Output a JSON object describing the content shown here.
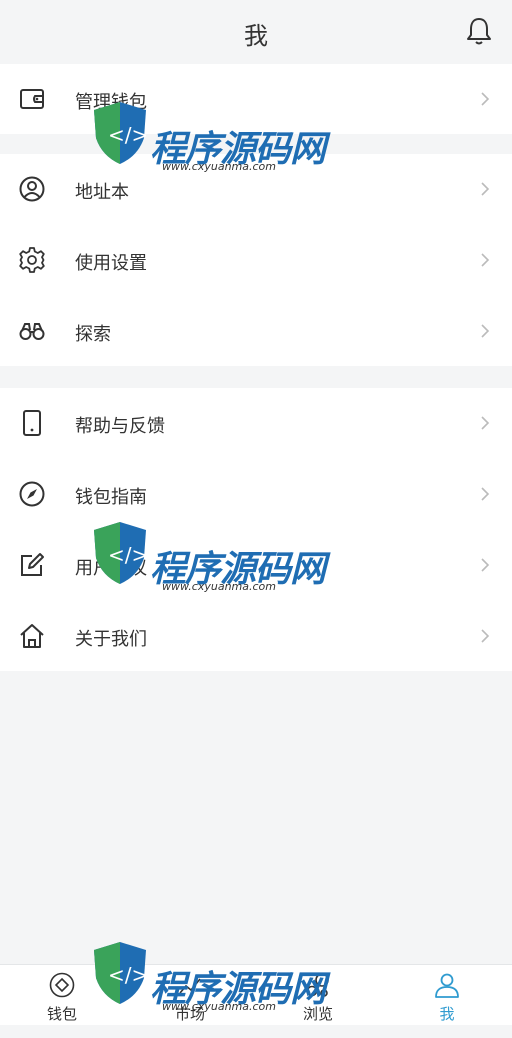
{
  "header": {
    "title": "我",
    "bell_icon": "bell-icon"
  },
  "groups": [
    {
      "items": [
        {
          "label": "管理钱包",
          "icon": "wallet-icon"
        }
      ]
    },
    {
      "items": [
        {
          "label": "地址本",
          "icon": "user-circle-icon"
        },
        {
          "label": "使用设置",
          "icon": "gear-icon"
        },
        {
          "label": "探索",
          "icon": "binoculars-icon"
        }
      ]
    },
    {
      "items": [
        {
          "label": "帮助与反馈",
          "icon": "phone-icon"
        },
        {
          "label": "钱包指南",
          "icon": "compass-icon"
        },
        {
          "label": "用户协议",
          "icon": "edit-icon"
        },
        {
          "label": "关于我们",
          "icon": "home-icon"
        }
      ]
    }
  ],
  "tabbar": {
    "tabs": [
      {
        "label": "钱包",
        "icon": "wallet-tab-icon"
      },
      {
        "label": "市场",
        "icon": "market-tab-icon"
      },
      {
        "label": "浏览",
        "icon": "browse-tab-icon"
      },
      {
        "label": "我",
        "icon": "user-tab-icon"
      }
    ],
    "active_color": "#2f9bd0"
  },
  "watermark": {
    "brand": "程序源码网",
    "url": "www.cxyuanma.com"
  }
}
